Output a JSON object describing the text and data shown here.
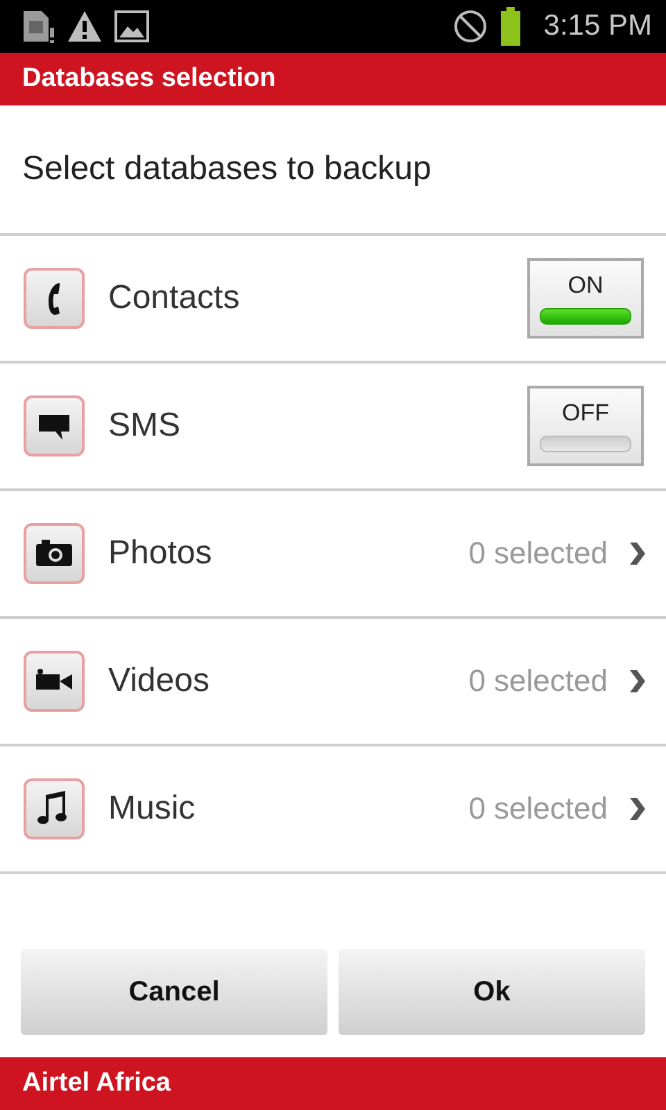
{
  "status_bar": {
    "time": "3:15 PM"
  },
  "title_bar": {
    "title": "Databases selection"
  },
  "heading": "Select databases to backup",
  "rows": [
    {
      "kind": "toggle",
      "label": "Contacts",
      "on": true,
      "toggle_text": "ON"
    },
    {
      "kind": "toggle",
      "label": "SMS",
      "on": false,
      "toggle_text": "OFF"
    },
    {
      "kind": "link",
      "label": "Photos",
      "count": "0 selected"
    },
    {
      "kind": "link",
      "label": "Videos",
      "count": "0 selected"
    },
    {
      "kind": "link",
      "label": "Music",
      "count": "0 selected"
    }
  ],
  "buttons": [
    "Cancel",
    "Ok"
  ],
  "footer": "Airtel Africa"
}
